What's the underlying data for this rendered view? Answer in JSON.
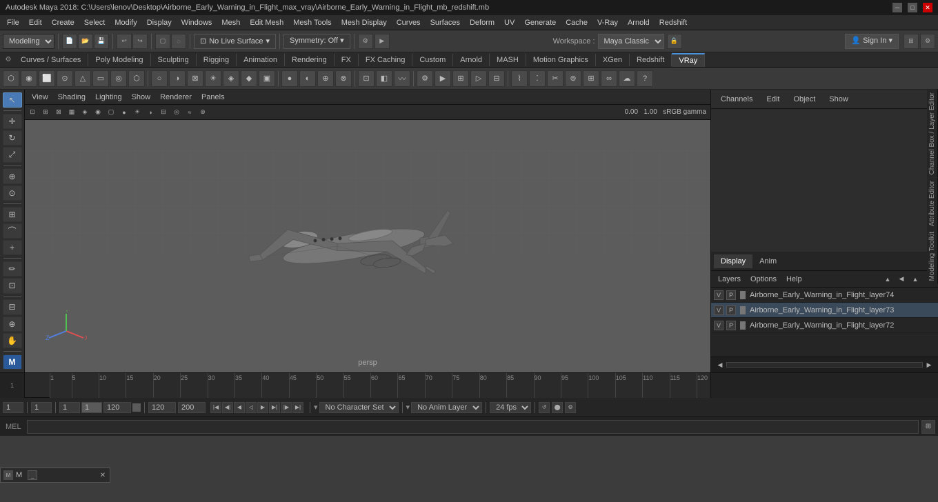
{
  "titlebar": {
    "title": "Autodesk Maya 2018: C:\\Users\\lenov\\Desktop\\Airborne_Early_Warning_in_Flight_max_vray\\Airborne_Early_Warning_in_Flight_mb_redshift.mb",
    "minimize": "─",
    "maximize": "□",
    "close": "✕"
  },
  "menubar": {
    "items": [
      "File",
      "Edit",
      "Create",
      "Select",
      "Modify",
      "Display",
      "Windows",
      "Mesh",
      "Edit Mesh",
      "Mesh Tools",
      "Mesh Display",
      "Curves",
      "Surfaces",
      "Deform",
      "UV",
      "Generate",
      "Cache",
      "V-Ray",
      "Arnold",
      "Redshift"
    ]
  },
  "toolbar": {
    "modeling_label": "Modeling",
    "live_surface": "No Live Surface",
    "symmetry": "Symmetry: Off",
    "sign_in": "Sign In",
    "workspace_label": "Workspace :",
    "workspace_value": "Maya Classic"
  },
  "tabs": {
    "items": [
      "Curves / Surfaces",
      "Poly Modeling",
      "Sculpting",
      "Rigging",
      "Animation",
      "Rendering",
      "FX",
      "FX Caching",
      "Custom",
      "Arnold",
      "MASH",
      "Motion Graphics",
      "XGen",
      "Redshift",
      "VRay"
    ]
  },
  "viewport": {
    "menus": [
      "View",
      "Shading",
      "Lighting",
      "Show",
      "Renderer",
      "Panels"
    ],
    "persp_label": "persp",
    "gamma_label": "sRGB gamma",
    "gamma_value": "0.00",
    "exposure_value": "1.00"
  },
  "channel_box": {
    "channels": "Channels",
    "edit": "Edit",
    "object": "Object",
    "show": "Show"
  },
  "layer_editor": {
    "display_tab": "Display",
    "anim_tab": "Anim",
    "layers": "Layers",
    "options": "Options",
    "help": "Help",
    "layers_list": [
      {
        "name": "Airborne_Early_Warning_in_Flight_layer74",
        "v": "V",
        "p": "P"
      },
      {
        "name": "Airborne_Early_Warning_in_Flight_layer73",
        "v": "V",
        "p": "P"
      },
      {
        "name": "Airborne_Early_Warning_in_Flight_layer72",
        "v": "V",
        "p": "P"
      }
    ]
  },
  "side_labels": {
    "channel_layer": "Channel Box / Layer Editor",
    "attribute": "Attribute Editor",
    "modeling_toolkit": "Modeling Toolkit"
  },
  "timeline": {
    "ruler_marks": [
      1,
      5,
      10,
      15,
      20,
      25,
      30,
      35,
      40,
      45,
      50,
      55,
      60,
      65,
      70,
      75,
      80,
      85,
      90,
      95,
      100,
      105,
      110,
      115,
      120
    ],
    "start_frame": "1",
    "end_frame": "120",
    "range_start": "1",
    "range_end": "120",
    "total_frames": "200"
  },
  "statusbar": {
    "frame_current": "1",
    "no_character_set": "No Character Set",
    "no_anim_layer": "No Anim Layer",
    "fps": "24 fps",
    "field1": "1",
    "field2": "1",
    "field3": "1",
    "field4": "120",
    "field5": "120",
    "field6": "200"
  },
  "mel": {
    "label": "MEL",
    "placeholder": ""
  },
  "bottom_dialog": {
    "label": "M",
    "close": "✕"
  },
  "icons": {
    "arrow": "↖",
    "move": "✛",
    "rotate": "↻",
    "scale": "⤢",
    "select": "▢",
    "lasso": "◌",
    "grid_icon": "⊞",
    "camera": "⊡",
    "eye": "👁",
    "light": "☀",
    "render": "▶"
  },
  "axes": {
    "x_color": "#e05050",
    "y_color": "#50c050",
    "z_color": "#5080e0"
  }
}
